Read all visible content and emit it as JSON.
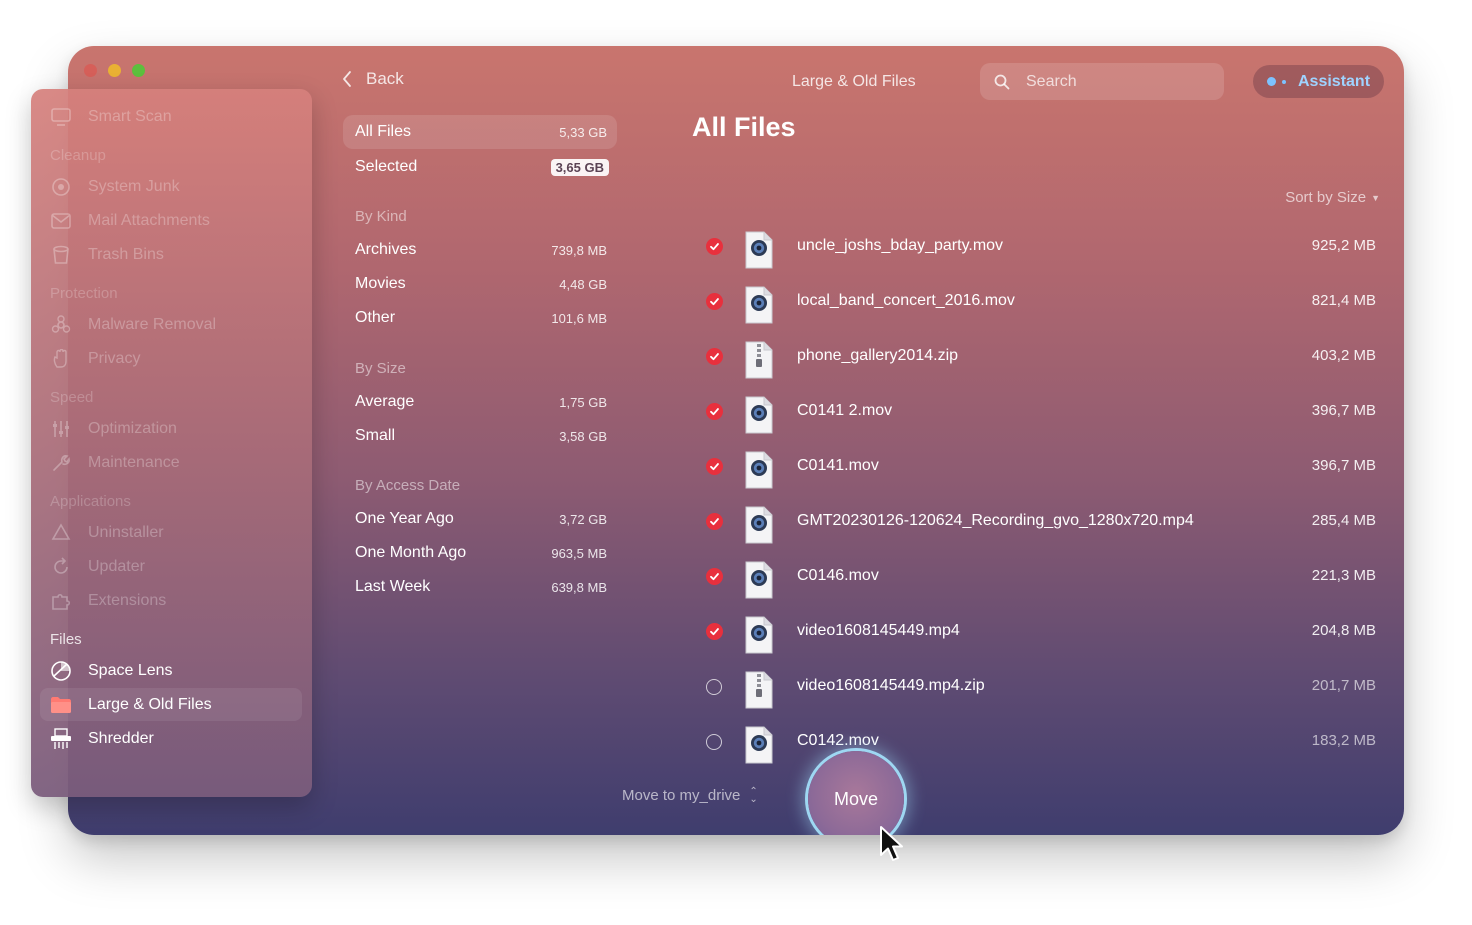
{
  "window": {
    "title": "Large & Old Files"
  },
  "header": {
    "back_label": "Back",
    "search_placeholder": "Search",
    "assistant_label": "Assistant"
  },
  "sidebar": {
    "smart_scan": "Smart Scan",
    "cleanup_head": "Cleanup",
    "system_junk": "System Junk",
    "mail_attachments": "Mail Attachments",
    "trash_bins": "Trash Bins",
    "protection_head": "Protection",
    "malware_removal": "Malware Removal",
    "privacy": "Privacy",
    "speed_head": "Speed",
    "optimization": "Optimization",
    "maintenance": "Maintenance",
    "applications_head": "Applications",
    "uninstaller": "Uninstaller",
    "updater": "Updater",
    "extensions": "Extensions",
    "files_head": "Files",
    "space_lens": "Space Lens",
    "large_old_files": "Large & Old Files",
    "shredder": "Shredder"
  },
  "categories": {
    "all_files": {
      "label": "All Files",
      "value": "5,33 GB"
    },
    "selected": {
      "label": "Selected",
      "value": "3,65 GB"
    },
    "by_kind_head": "By Kind",
    "archives": {
      "label": "Archives",
      "value": "739,8 MB"
    },
    "movies": {
      "label": "Movies",
      "value": "4,48 GB"
    },
    "other": {
      "label": "Other",
      "value": "101,6 MB"
    },
    "by_size_head": "By Size",
    "average": {
      "label": "Average",
      "value": "1,75 GB"
    },
    "small": {
      "label": "Small",
      "value": "3,58 GB"
    },
    "by_access_head": "By Access Date",
    "one_year": {
      "label": "One Year Ago",
      "value": "3,72 GB"
    },
    "one_month": {
      "label": "One Month Ago",
      "value": "963,5 MB"
    },
    "last_week": {
      "label": "Last Week",
      "value": "639,8 MB"
    }
  },
  "main": {
    "title": "All Files",
    "sort_label": "Sort by Size"
  },
  "files": [
    {
      "name": "uncle_joshs_bday_party.mov",
      "size": "925,2 MB",
      "type_label": "MOV",
      "kind": "movie",
      "checked": true
    },
    {
      "name": "local_band_concert_2016.mov",
      "size": "821,4 MB",
      "type_label": "MOV",
      "kind": "movie",
      "checked": true
    },
    {
      "name": "phone_gallery2014.zip",
      "size": "403,2 MB",
      "type_label": "ZIP",
      "kind": "archive",
      "checked": true
    },
    {
      "name": "C0141 2.mov",
      "size": "396,7 MB",
      "type_label": "MOV",
      "kind": "movie",
      "checked": true
    },
    {
      "name": "C0141.mov",
      "size": "396,7 MB",
      "type_label": "MOV",
      "kind": "movie",
      "checked": true
    },
    {
      "name": "GMT20230126-120624_Recording_gvo_1280x720.mp4",
      "size": "285,4 MB",
      "type_label": "MP4",
      "kind": "movie",
      "checked": true
    },
    {
      "name": "C0146.mov",
      "size": "221,3 MB",
      "type_label": "MOV",
      "kind": "movie",
      "checked": true
    },
    {
      "name": "video1608145449.mp4",
      "size": "204,8 MB",
      "type_label": "MP4",
      "kind": "movie",
      "checked": true
    },
    {
      "name": "video1608145449.mp4.zip",
      "size": "201,7 MB",
      "type_label": "ZIP",
      "kind": "archive",
      "checked": false
    },
    {
      "name": "C0142.mov",
      "size": "183,2 MB",
      "type_label": "MOV",
      "kind": "movie",
      "checked": false
    }
  ],
  "footer": {
    "move_to_label": "Move to my_drive",
    "move_button": "Move"
  },
  "colors": {
    "accent_check": "#e8303d",
    "assistant_text": "#9fd3ff",
    "move_ring": "#9ed7f2"
  }
}
